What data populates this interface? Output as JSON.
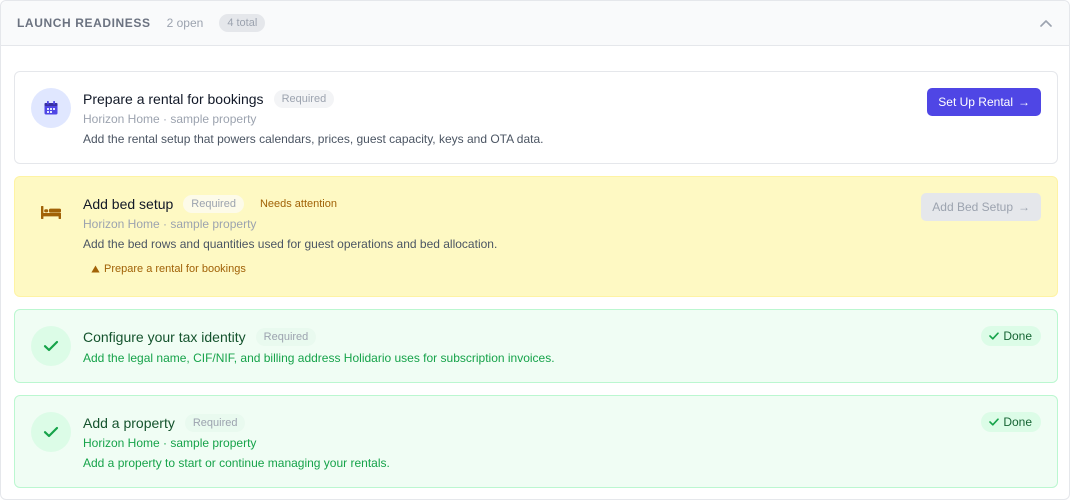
{
  "header": {
    "title": "LAUNCH READINESS",
    "open_count": "2 open",
    "total_count": "4 total",
    "toggle_icon": "chevron-up-icon"
  },
  "colors": {
    "accent": "#4f46e5",
    "warning_bg": "#fef9c3",
    "success_bg": "#f0fdf4",
    "success_text": "#16a34a"
  },
  "tasks": [
    {
      "state": "pending",
      "icon": "calendar-icon",
      "title": "Prepare a rental for bookings",
      "required_label": "Required",
      "subtitle": "Horizon Home · sample property",
      "description": "Add the rental setup that powers calendars, prices, guest capacity, keys and OTA data.",
      "action_label": "Set Up Rental",
      "action_arrow": "→"
    },
    {
      "state": "blocked",
      "icon": "bed-icon",
      "title": "Add bed setup",
      "required_label": "Required",
      "attention_label": "Needs attention",
      "subtitle": "Horizon Home · sample property",
      "description": "Add the bed rows and quantities used for guest operations and bed allocation.",
      "dependency": "Prepare a rental for bookings",
      "action_label": "Add Bed Setup",
      "action_arrow": "→"
    },
    {
      "state": "done",
      "icon": "check-icon",
      "title": "Configure your tax identity",
      "required_label": "Required",
      "description": "Add the legal name, CIF/NIF, and billing address Holidario uses for subscription invoices.",
      "status_label": "Done"
    },
    {
      "state": "done",
      "icon": "check-icon",
      "title": "Add a property",
      "required_label": "Required",
      "subtitle": "Horizon Home · sample property",
      "description": "Add a property to start or continue managing your rentals.",
      "status_label": "Done"
    }
  ]
}
